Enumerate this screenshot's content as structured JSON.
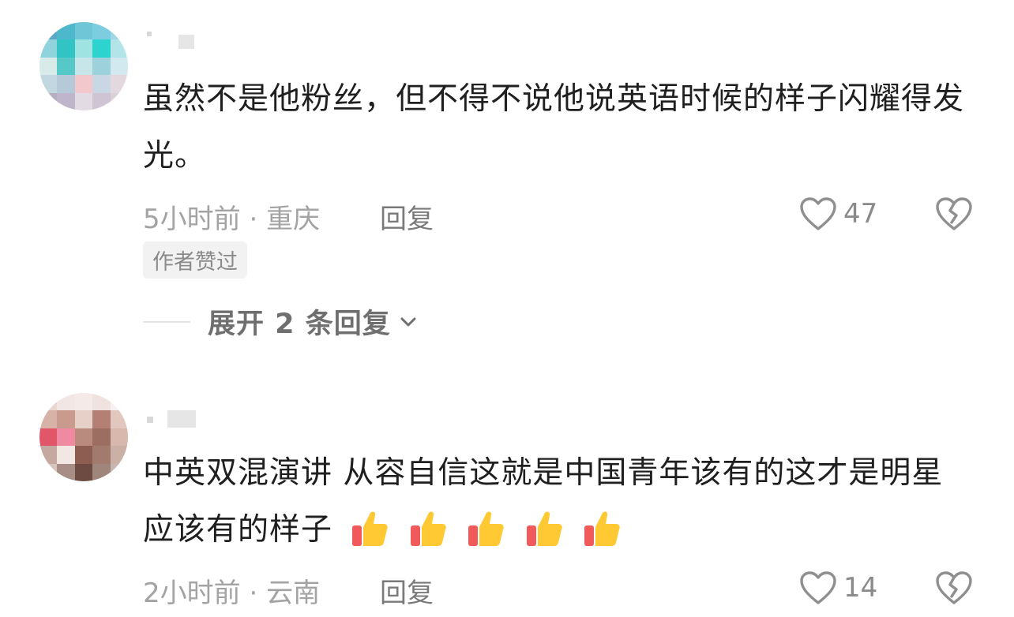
{
  "comments": [
    {
      "text": "虽然不是他粉丝，但不得不说他说英语时候的样子闪耀得发光。",
      "time": "5小时前",
      "location": "重庆",
      "reply_label": "回复",
      "like_count": "47",
      "author_badge": "作者赞过",
      "expand_label": "展开 2 条回复",
      "emojis": []
    },
    {
      "text": "中英双混演讲 从容自信这就是中国青年该有的这才是明星应该有的样子",
      "time": "2小时前",
      "location": "云南",
      "reply_label": "回复",
      "like_count": "14",
      "emojis": [
        "thumbs-up",
        "thumbs-up",
        "thumbs-up",
        "thumbs-up",
        "thumbs-up"
      ]
    }
  ],
  "separator": "·",
  "icons": {
    "like": "heart-outline-icon",
    "dislike": "broken-heart-icon",
    "expand": "chevron-down-icon"
  },
  "colors": {
    "text": "#1f1f1f",
    "meta": "#a3a3a3",
    "badge_bg": "#f2f2f2"
  }
}
